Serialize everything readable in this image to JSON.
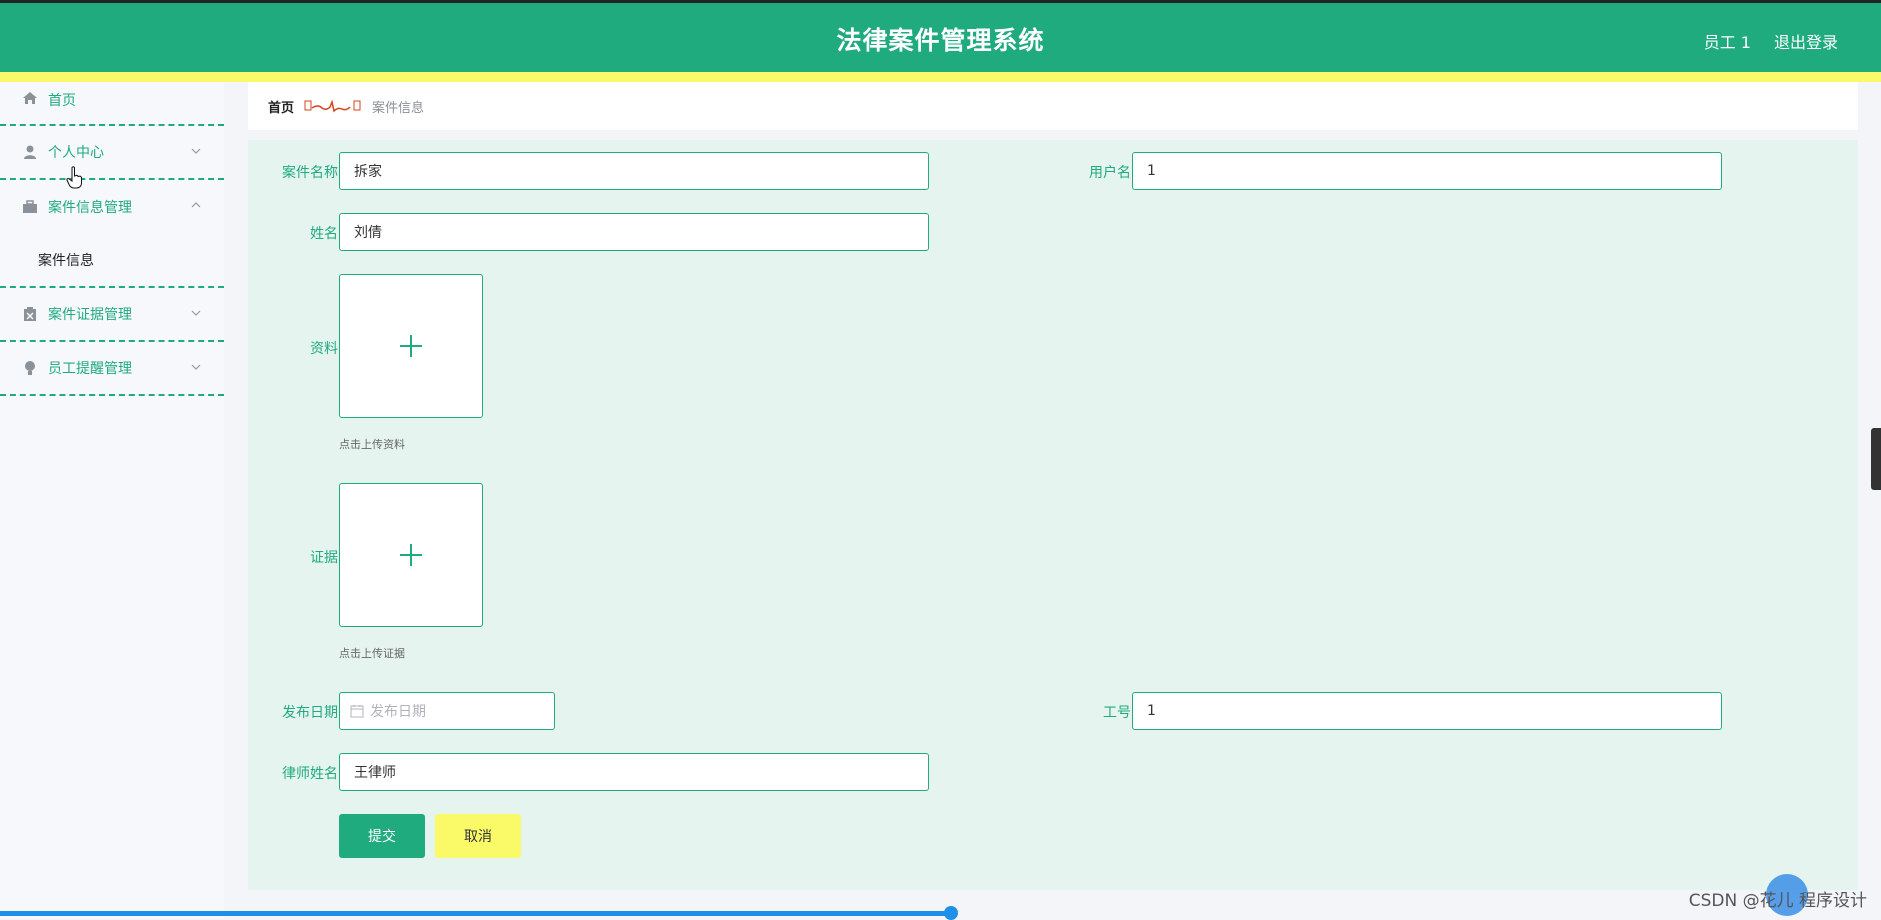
{
  "header": {
    "title": "法律案件管理系统",
    "user": "员工 1",
    "logout": "退出登录"
  },
  "sidebar": {
    "items": [
      {
        "label": "首页",
        "icon": "home-icon"
      },
      {
        "label": "个人中心",
        "icon": "person-icon"
      },
      {
        "label": "案件信息管理",
        "icon": "briefcase-icon",
        "expanded": true,
        "children": [
          "案件信息"
        ]
      },
      {
        "label": "案件证据管理",
        "icon": "clipboard-icon"
      },
      {
        "label": "员工提醒管理",
        "icon": "bulb-icon"
      }
    ]
  },
  "breadcrumb": {
    "home": "首页",
    "current": "案件信息"
  },
  "form": {
    "case_name_label": "案件名称",
    "case_name_value": "拆家",
    "username_label": "用户名",
    "username_value": "1",
    "name_label": "姓名",
    "name_value": "刘倩",
    "materials_label": "资料",
    "materials_hint": "点击上传资料",
    "evidence_label": "证据",
    "evidence_hint": "点击上传证据",
    "publish_date_label": "发布日期",
    "publish_date_placeholder": "发布日期",
    "employee_no_label": "工号",
    "employee_no_value": "1",
    "lawyer_label": "律师姓名",
    "lawyer_value": "王律师",
    "submit": "提交",
    "cancel": "取消"
  },
  "watermark": "CSDN @花儿 程序设计",
  "colors": {
    "primary": "#1fab7d",
    "accent_yellow": "#fafa68",
    "panel_bg": "#e6f4f0"
  }
}
